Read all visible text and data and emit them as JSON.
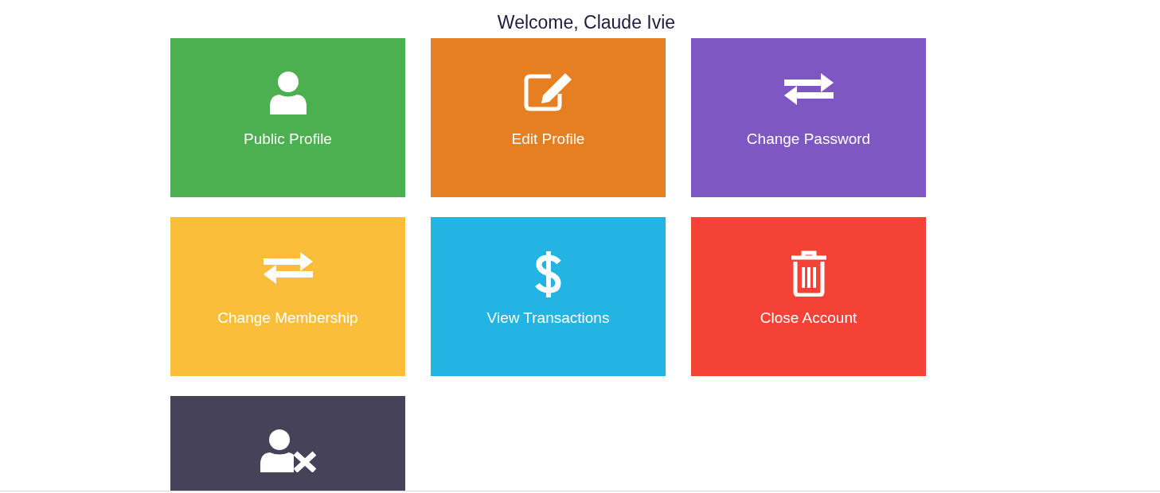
{
  "heading": "Welcome, Claude Ivie",
  "tiles": [
    {
      "label": "Public Profile",
      "color": "#4caf50",
      "kind": "user"
    },
    {
      "label": "Edit Profile",
      "color": "#e67e22",
      "kind": "edit"
    },
    {
      "label": "Change Password",
      "color": "#7e57c2",
      "kind": "exchange"
    },
    {
      "label": "Change Membership",
      "color": "#f9bf3b",
      "kind": "exchange"
    },
    {
      "label": "View Transactions",
      "color": "#22b5e3",
      "kind": "dollar"
    },
    {
      "label": "Close Account",
      "color": "#f44336",
      "kind": "trash"
    },
    {
      "color": "#45425a",
      "kind": "user-remove"
    }
  ]
}
